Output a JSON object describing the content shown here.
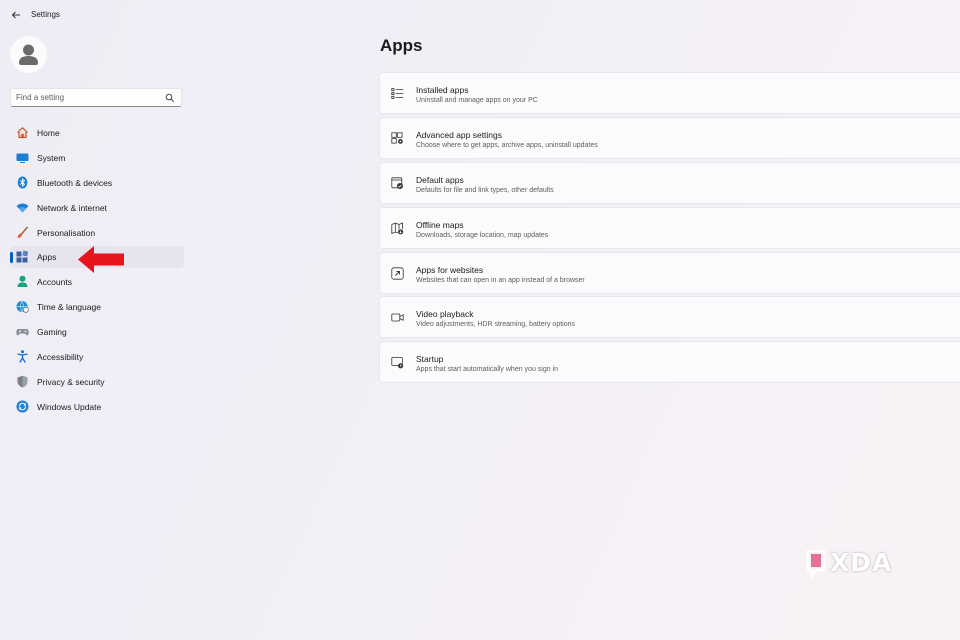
{
  "window": {
    "title": "Settings"
  },
  "search": {
    "placeholder": "Find a setting"
  },
  "sidebar": {
    "items": [
      {
        "label": "Home",
        "icon": "home-icon",
        "active": false
      },
      {
        "label": "System",
        "icon": "system-icon",
        "active": false
      },
      {
        "label": "Bluetooth & devices",
        "icon": "bluetooth-icon",
        "active": false
      },
      {
        "label": "Network & internet",
        "icon": "wifi-icon",
        "active": false
      },
      {
        "label": "Personalisation",
        "icon": "brush-icon",
        "active": false
      },
      {
        "label": "Apps",
        "icon": "apps-icon",
        "active": true
      },
      {
        "label": "Accounts",
        "icon": "person-icon",
        "active": false
      },
      {
        "label": "Time & language",
        "icon": "globe-clock-icon",
        "active": false
      },
      {
        "label": "Gaming",
        "icon": "gamepad-icon",
        "active": false
      },
      {
        "label": "Accessibility",
        "icon": "accessibility-icon",
        "active": false
      },
      {
        "label": "Privacy & security",
        "icon": "shield-icon",
        "active": false
      },
      {
        "label": "Windows Update",
        "icon": "update-icon",
        "active": false
      }
    ]
  },
  "main": {
    "title": "Apps",
    "cards": [
      {
        "title": "Installed apps",
        "description": "Uninstall and manage apps on your PC",
        "icon": "list-icon"
      },
      {
        "title": "Advanced app settings",
        "description": "Choose where to get apps, archive apps, uninstall updates",
        "icon": "app-gear-icon"
      },
      {
        "title": "Default apps",
        "description": "Defaults for file and link types, other defaults",
        "icon": "default-check-icon"
      },
      {
        "title": "Offline maps",
        "description": "Downloads, storage location, map updates",
        "icon": "map-icon"
      },
      {
        "title": "Apps for websites",
        "description": "Websites that can open in an app instead of a browser",
        "icon": "external-link-icon"
      },
      {
        "title": "Video playback",
        "description": "Video adjustments, HDR streaming, battery options",
        "icon": "video-icon"
      },
      {
        "title": "Startup",
        "description": "Apps that start automatically when you sign in",
        "icon": "startup-icon"
      }
    ]
  },
  "watermark": {
    "text": "XDA"
  },
  "colors": {
    "accent": "#005fb8",
    "annotation_arrow": "#e8141b"
  }
}
